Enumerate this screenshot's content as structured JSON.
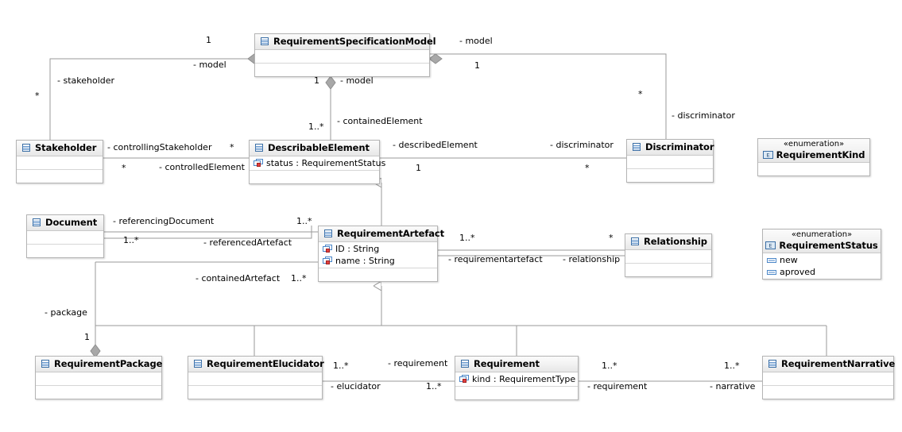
{
  "diagram": {
    "title": "Requirement Specification Model UML Class Diagram",
    "type": "uml-class-diagram",
    "colors": {
      "box_border": "#b4b4b4",
      "header_gradient_top": "#fbfbfb",
      "header_gradient_bottom": "#e7e7e7",
      "line": "#9a9a9a",
      "diamond_fill": "#a8a8a8",
      "attr_icon_blue": "#4a86c8",
      "attr_icon_red": "#e04040",
      "background": "#ffffff"
    },
    "classes": [
      {
        "id": "rsm",
        "name": "RequirementSpecificationModel",
        "icon": "class-icon",
        "attributes": [],
        "compartments": 2
      },
      {
        "id": "stakeholder",
        "name": "Stakeholder",
        "icon": "class-icon",
        "attributes": [],
        "compartments": 2
      },
      {
        "id": "describableelement",
        "name": "DescribableElement",
        "icon": "class-icon",
        "attributes": [
          {
            "name": "status : RequirementStatus",
            "icon": "attribute-icon"
          }
        ],
        "compartments": 2
      },
      {
        "id": "discriminator",
        "name": "Discriminator",
        "icon": "class-icon",
        "attributes": [],
        "compartments": 2
      },
      {
        "id": "document",
        "name": "Document",
        "icon": "class-icon",
        "attributes": [],
        "compartments": 2
      },
      {
        "id": "requirementartefact",
        "name": "RequirementArtefact",
        "icon": "class-icon",
        "attributes": [
          {
            "name": "ID : String",
            "icon": "attribute-icon"
          },
          {
            "name": "name : String",
            "icon": "attribute-icon"
          }
        ],
        "compartments": 2
      },
      {
        "id": "relationship",
        "name": "Relationship",
        "icon": "class-icon",
        "attributes": [],
        "compartments": 2
      },
      {
        "id": "requirementpackage",
        "name": "RequirementPackage",
        "icon": "class-icon",
        "attributes": [],
        "compartments": 2
      },
      {
        "id": "requirementelucidator",
        "name": "RequirementElucidator",
        "icon": "class-icon",
        "attributes": [],
        "compartments": 2
      },
      {
        "id": "requirement",
        "name": "Requirement",
        "icon": "class-icon",
        "attributes": [
          {
            "name": "kind : RequirementType",
            "icon": "attribute-icon"
          }
        ],
        "compartments": 2
      },
      {
        "id": "requirementnarrative",
        "name": "RequirementNarrative",
        "icon": "class-icon",
        "attributes": [],
        "compartments": 2
      }
    ],
    "enumerations": [
      {
        "id": "requirementkind",
        "stereotype": "«enumeration»",
        "name": "RequirementKind",
        "icon": "enumeration-icon",
        "literals": []
      },
      {
        "id": "requirementstatus",
        "stereotype": "«enumeration»",
        "name": "RequirementStatus",
        "icon": "enumeration-icon",
        "literals": [
          {
            "name": "new",
            "icon": "literal-icon"
          },
          {
            "name": "aproved",
            "icon": "literal-icon"
          }
        ]
      }
    ],
    "labels": {
      "model_top_left_mult": "1",
      "model_role_left": "- model",
      "stakeholder_role": "- stakeholder",
      "stakeholder_mult_star": "*",
      "model_role_right": "- model",
      "model_right_mult": "1",
      "discriminator_mult_star": "*",
      "discriminator_role_right": "- discriminator",
      "model_mid_mult": "1",
      "model_role_mid": "- model",
      "containedelement_mult": "1..*",
      "containedelement_role": "- containedElement",
      "controllingstakeholder_role": "- controllingStakeholder",
      "controllingstakeholder_mult": "*",
      "controlledelement_mult": "*",
      "controlledelement_role": "- controlledElement",
      "describedelement_role": "- describedElement",
      "describedelement_mult": "1",
      "discriminator_role_mid": "- discriminator",
      "discriminator_mult_mid": "*",
      "referencingdocument_role": "- referencingDocument",
      "referencingdocument_mult": "1..*",
      "referencedartefact_role": "- referencedArtefact",
      "referencedartefact_mult": "1..*",
      "requirementartefact_mult": "1..*",
      "requirementartefact_role": "- requirementartefact",
      "relationship_role": "- relationship",
      "relationship_mult": "*",
      "containedartefact_role": "- containedArtefact",
      "containedartefact_mult": "1..*",
      "package_role": "- package",
      "package_mult": "1",
      "requirement_role_left": "- requirement",
      "requirement_mult_left": "1..*",
      "elucidator_role": "- elucidator",
      "elucidator_mult": "1..*",
      "requirement_role_right": "- requirement",
      "requirement_mult_right": "1..*",
      "narrative_role": "- narrative",
      "narrative_mult": "1..*"
    }
  }
}
